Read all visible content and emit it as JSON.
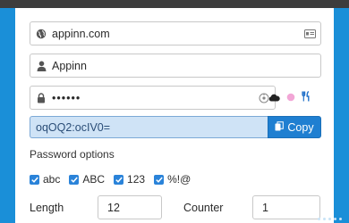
{
  "domain_field": {
    "value": "appinn.com",
    "lead_icon": "globe-icon",
    "trail_icon": "card-icon"
  },
  "user_field": {
    "value": "Appinn",
    "lead_icon": "user-icon"
  },
  "password_field": {
    "value": "••••••",
    "lead_icon": "lock-icon",
    "trail_icon": "reveal-icon"
  },
  "indicator_icons": [
    "cloud-icon",
    "pink-dot-icon",
    "fork-knife-icon"
  ],
  "generated": {
    "value": "oqOQ2:ocIV0=",
    "copy_label": "Copy",
    "copy_icon": "copy-icon"
  },
  "options": {
    "title": "Password options",
    "items": [
      {
        "label": "abc",
        "checked": true
      },
      {
        "label": "ABC",
        "checked": true
      },
      {
        "label": "123",
        "checked": true
      },
      {
        "label": "%!@",
        "checked": true
      }
    ]
  },
  "length": {
    "label": "Length",
    "value": "12"
  },
  "counter": {
    "label": "Counter",
    "value": "1"
  },
  "colors": {
    "accent": "#1f7fd1",
    "background": "#1a8fd8",
    "selection": "#cfe3f6"
  }
}
